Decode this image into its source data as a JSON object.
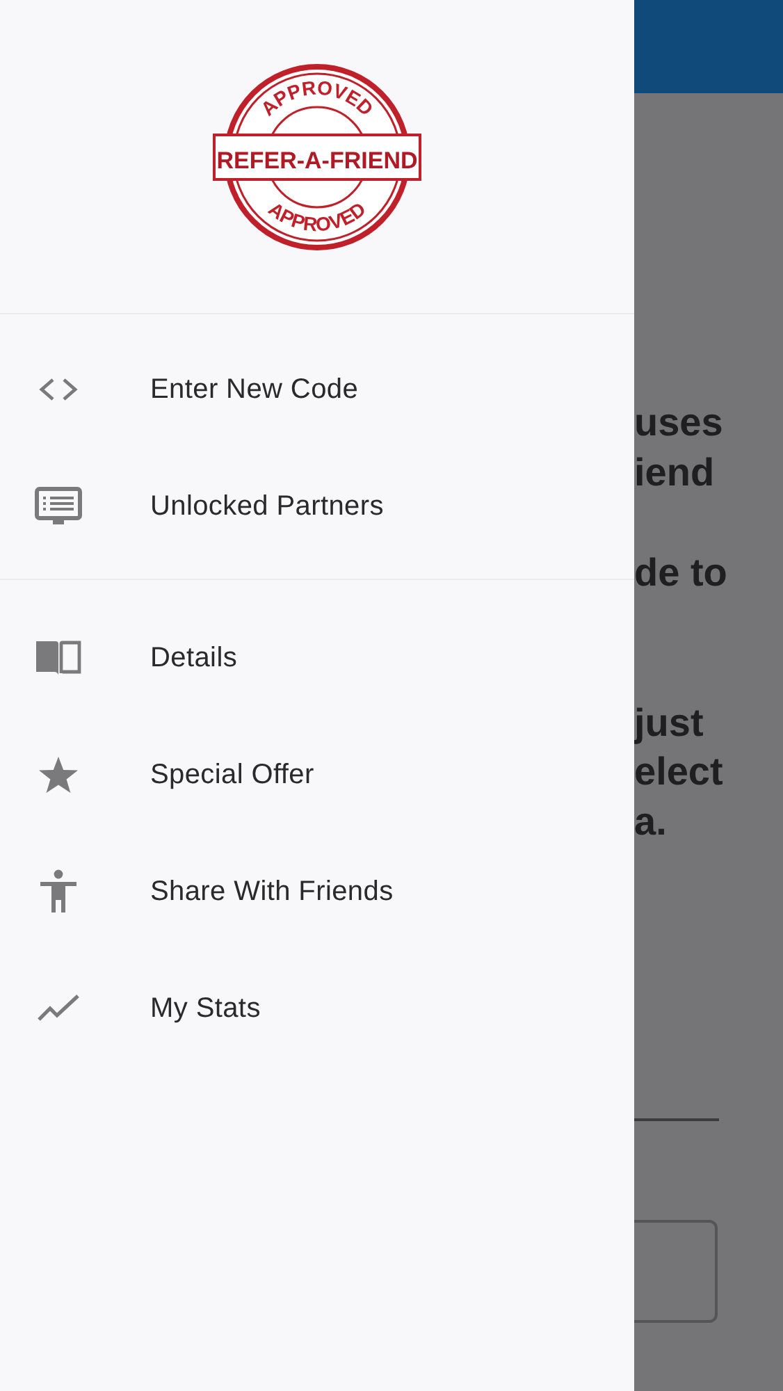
{
  "drawer": {
    "logo": {
      "top_text": "APPROVED",
      "main_text": "REFER-A-FRIEND",
      "bottom_text": "APPROVED"
    },
    "sections": [
      {
        "items": [
          {
            "kind": "code",
            "label": "Enter New Code"
          },
          {
            "kind": "list",
            "label": "Unlocked Partners"
          }
        ]
      },
      {
        "items": [
          {
            "kind": "book",
            "label": "Details"
          },
          {
            "kind": "star",
            "label": "Special Offer"
          },
          {
            "kind": "person",
            "label": "Share With Friends"
          },
          {
            "kind": "chart",
            "label": "My Stats"
          }
        ]
      }
    ]
  },
  "background_page": {
    "paragraphs": [
      [
        "uses",
        "iend"
      ],
      [
        "de to"
      ],
      [
        "just",
        "elect",
        "a."
      ]
    ]
  }
}
